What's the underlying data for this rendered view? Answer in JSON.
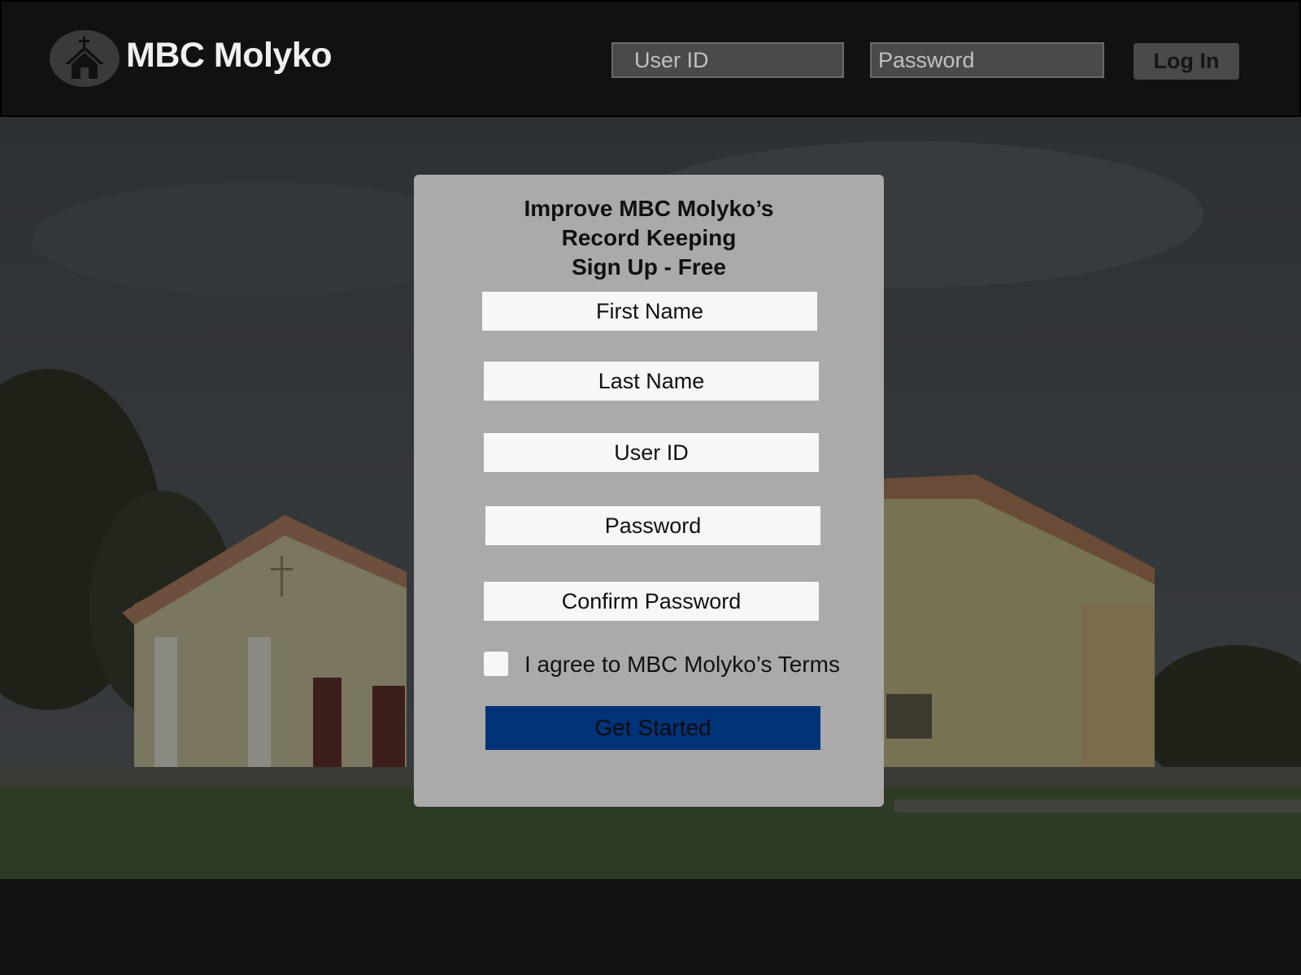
{
  "header": {
    "brand_title": "MBC Molyko",
    "brand_icon": "church-icon",
    "userid_placeholder": "User ID",
    "password_placeholder": "Password",
    "login_label": "Log In"
  },
  "signup": {
    "title_lines": [
      "Improve MBC Molyko’s",
      "Record Keeping",
      "Sign Up - Free"
    ],
    "fields": {
      "first_name": "First Name",
      "last_name": "Last Name",
      "user_id": "User ID",
      "password": "Password",
      "confirm_password": "Confirm Password"
    },
    "terms_label": "I agree to MBC Molyko’s Terms",
    "terms_checked": false,
    "submit_label": "Get Started"
  },
  "colors": {
    "background": "#111111",
    "card": "#aaaaaa",
    "field": "#f7f7f7",
    "submit": "#003377"
  }
}
